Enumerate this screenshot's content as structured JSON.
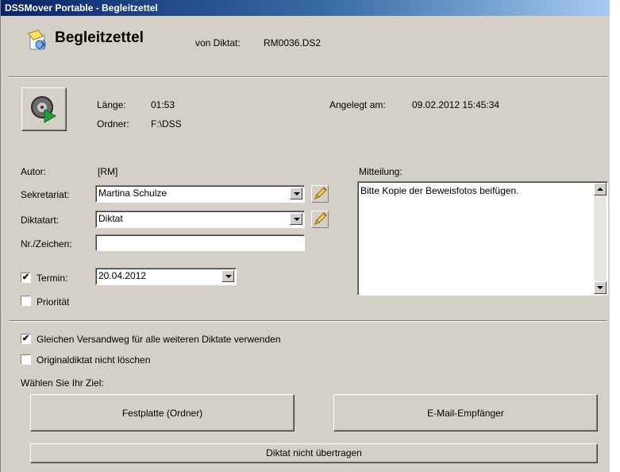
{
  "window": {
    "title": "DSSMover Portable - Begleitzettel"
  },
  "header": {
    "title": "Begleitzettel",
    "von_label": "von Diktat:",
    "von_value": "RM0036.DS2"
  },
  "info": {
    "laenge_label": "Länge:",
    "laenge_value": "01:53",
    "ordner_label": "Ordner:",
    "ordner_value": "F:\\DSS",
    "angelegt_label": "Angelegt am:",
    "angelegt_value": "09.02.2012  15:45:34"
  },
  "form": {
    "autor_label": "Autor:",
    "autor_value": "[RM]",
    "sekretariat_label": "Sekretariat:",
    "sekretariat_value": "Martina Schulze",
    "diktatart_label": "Diktatart:",
    "diktatart_value": "Diktat",
    "nr_label": "Nr./Zeichen:",
    "nr_value": "",
    "termin_label": "Termin:",
    "termin_value": "20.04.2012",
    "termin_checked": "✔",
    "prioritaet_label": "Priorität",
    "prioritaet_checked": ""
  },
  "mitteilung": {
    "label": "Mitteilung:",
    "text": "Bitte Kopie der Beweisfotos beifügen."
  },
  "options": {
    "gleichen_label": "Gleichen Versandweg für alle weiteren Diktate verwenden",
    "gleichen_checked": "✔",
    "original_label": "Originaldiktat nicht löschen",
    "original_checked": ""
  },
  "ziel": {
    "label": "Wählen Sie Ihr Ziel:",
    "festplatte_button": "Festplatte (Ordner)",
    "email_button": "E-Mail-Empfänger",
    "nicht_button": "Diktat nicht übertragen"
  },
  "colors": {
    "titlebar": "#0a246a",
    "window_bg": "#d4d0c8",
    "play_green": "#1fa033"
  }
}
